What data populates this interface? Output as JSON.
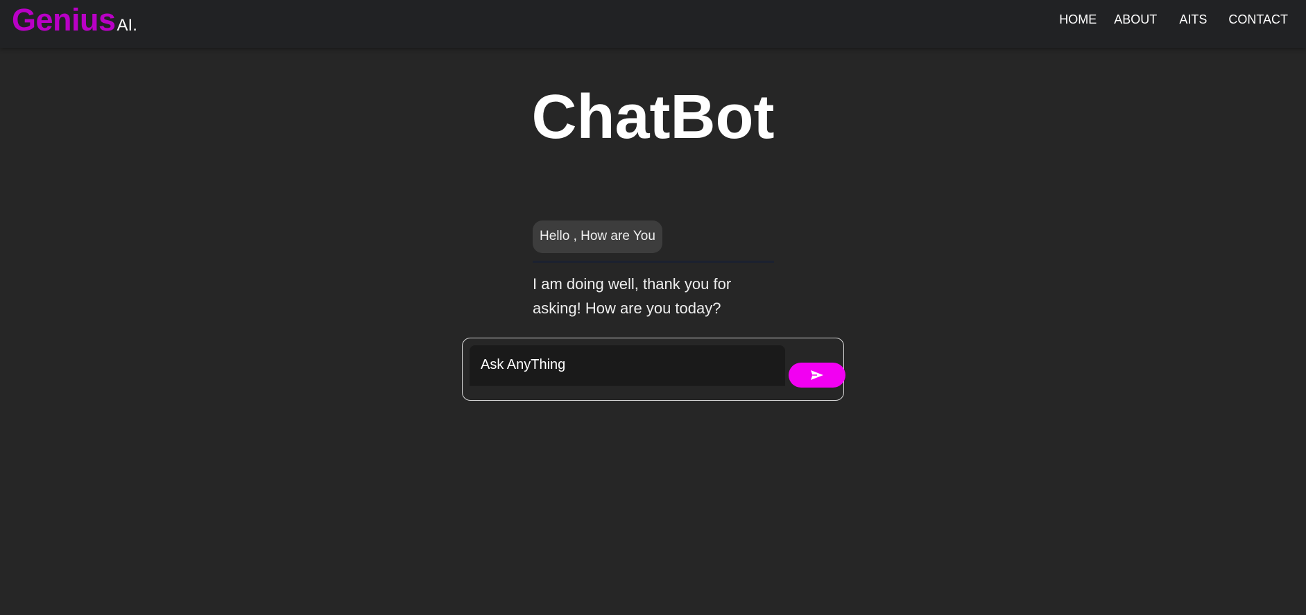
{
  "brand": {
    "name": "Genius",
    "suffix": "AI."
  },
  "nav": {
    "items": [
      {
        "label": "HOME"
      },
      {
        "label": "ABOUT"
      },
      {
        "label": "AITS"
      },
      {
        "label": "CONTACT"
      }
    ]
  },
  "page": {
    "title": "ChatBot"
  },
  "chat": {
    "messages": [
      {
        "role": "user",
        "text": "Hello , How are You"
      },
      {
        "role": "bot",
        "text": "I am doing well, thank you for asking! How are you today?"
      }
    ]
  },
  "input": {
    "placeholder": "Ask AnyThing",
    "value": ""
  },
  "send_button": {
    "icon": "send-icon"
  },
  "colors": {
    "background": "#262626",
    "navbar": "#212224",
    "brand": "#b900c6",
    "accent": "#f200f2",
    "user_bubble": "#3d3d3d"
  }
}
